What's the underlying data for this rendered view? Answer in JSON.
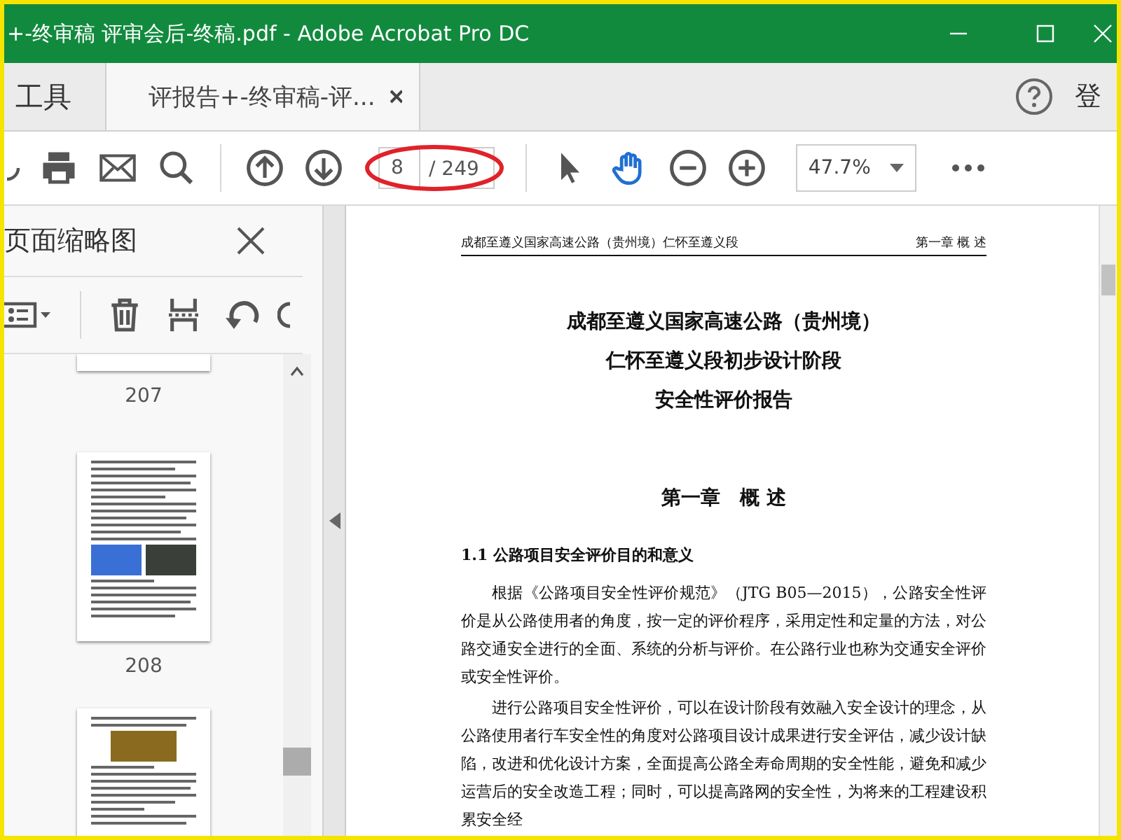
{
  "window": {
    "title": "+-终审稿 评审会后-终稿.pdf - Adobe Acrobat Pro DC"
  },
  "tabs": [
    {
      "label": "工具",
      "selected": false
    },
    {
      "label": "评报告+-终审稿-评...",
      "selected": true
    }
  ],
  "account": {
    "label": "登"
  },
  "toolbar": {
    "page": {
      "value": "8",
      "total": "/ 249"
    },
    "zoom": {
      "value": "47.7%"
    },
    "tools": [
      {
        "kind": "select",
        "selected": false
      },
      {
        "kind": "hand",
        "selected": true
      }
    ]
  },
  "sidebar": {
    "title": "页面缩略图",
    "thumbnails": [
      {
        "label": "207"
      },
      {
        "label": "208"
      }
    ]
  },
  "document": {
    "header_left": "成都至遵义国家高速公路（贵州境）仁怀至遵义段",
    "header_right": "第一章 概 述",
    "title_lines": [
      "成都至遵义国家高速公路（贵州境）",
      "仁怀至遵义段初步设计阶段",
      "安全性评价报告"
    ],
    "chapter": "第一章　概 述",
    "section": "1.1 公路项目安全评价目的和意义",
    "paragraphs": [
      "根据《公路项目安全性评价规范》（JTG B05—2015），公路安全性评价是从公路使用者的角度，按一定的评价程序，采用定性和定量的方法，对公路交通安全进行的全面、系统的分析与评价。在公路行业也称为交通安全评价或安全性评价。",
      "进行公路项目安全性评价，可以在设计阶段有效融入安全设计的理念，从公路使用者行车安全性的角度对公路项目设计成果进行安全评估，减少设计缺陷，改进和优化设计方案，全面提高公路全寿命周期的安全性能，避免和减少运营后的安全改造工程；同时，可以提高路网的安全性，为将来的工程建设积累安全经"
    ]
  }
}
